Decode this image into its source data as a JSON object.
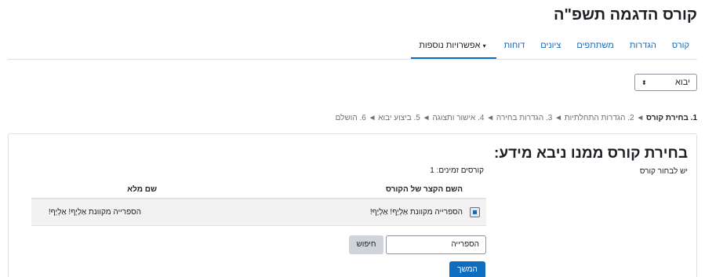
{
  "page": {
    "title": "קורס הדגמה תשפ\"ה"
  },
  "nav": {
    "items": [
      {
        "label": "קורס"
      },
      {
        "label": "הגדרות"
      },
      {
        "label": "משתתפים"
      },
      {
        "label": "ציונים"
      },
      {
        "label": "דוחות"
      },
      {
        "label": "אפשרויות נוספות"
      }
    ],
    "active_index": 5
  },
  "import_select": {
    "value": "יבוא"
  },
  "steps": {
    "current": "1. בחירת קורס",
    "rest": "◄ 2. הגדרות התחלתיות ◄ 3. הגדרות בחירה ◄ 4. אישור ותצוגה ◄ 5. ביצוע יבוא ◄ 6. הושלם"
  },
  "section": {
    "title": "בחירת קורס ממנו ניבא מידע:",
    "note": "יש לבחור קורס",
    "available_label": "קורסים זמינים: 1"
  },
  "table": {
    "headers": {
      "shortname": "השם הקצר של הקורס",
      "fullname": "שם מלא"
    },
    "rows": [
      {
        "shortname": "הספרייה מקוונת אַלְיָף! אַלְיָף!",
        "fullname": "הספרייה מקוונת אַלְיָף! אַלְיָף!",
        "selected": true
      }
    ]
  },
  "search": {
    "value": "הספרייה",
    "button_label": "חיפוש"
  },
  "continue_label": "המשך",
  "colors": {
    "accent": "#0f6cbf",
    "row_bg": "#f2f2f2"
  }
}
